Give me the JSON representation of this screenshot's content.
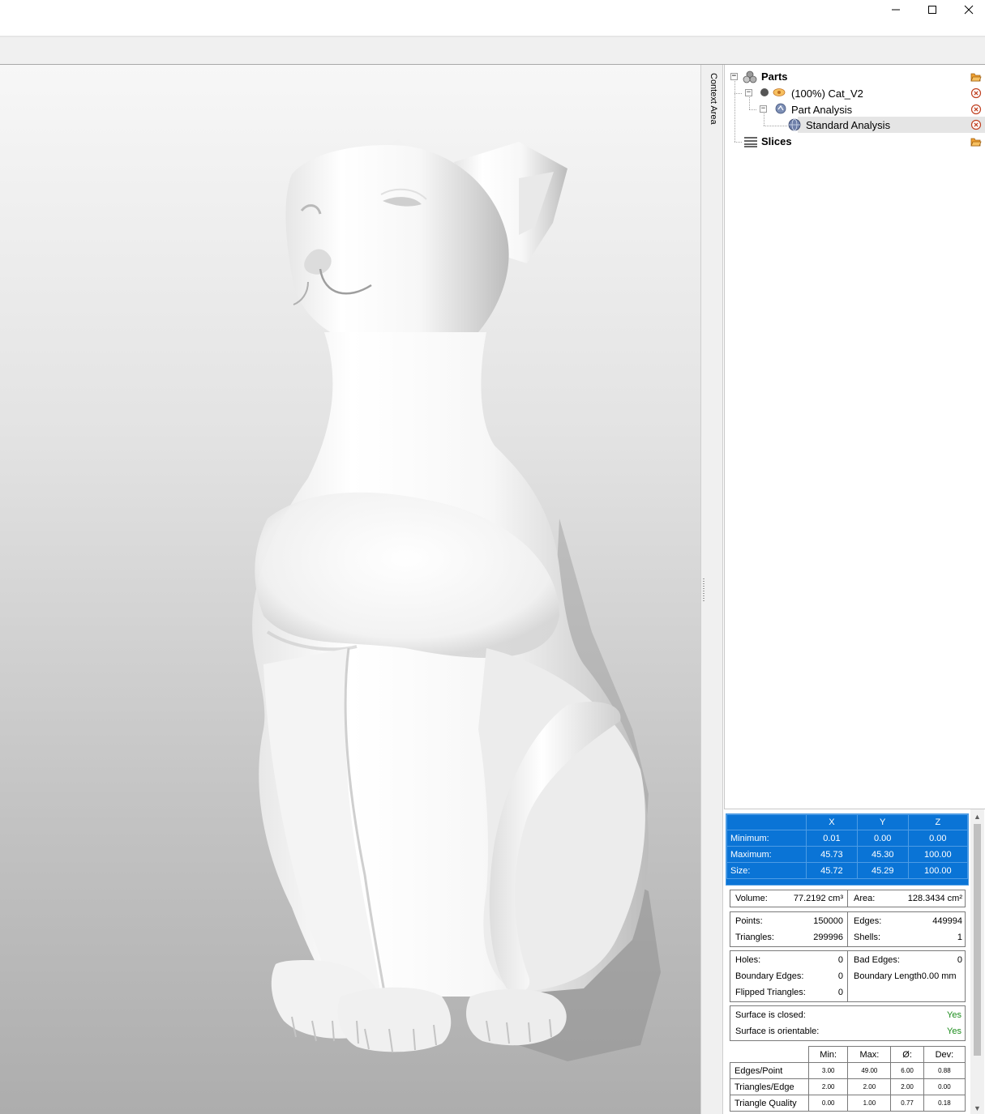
{
  "window": {
    "controls": [
      "minimize",
      "maximize",
      "close"
    ]
  },
  "viewport": {
    "model_name": "Cat_V2"
  },
  "context_tab": {
    "label": "Context Area"
  },
  "tree": {
    "parts_label": "Parts",
    "part_label": "(100%) Cat_V2",
    "analysis_label": "Part Analysis",
    "standard_analysis_label": "Standard Analysis",
    "slices_label": "Slices",
    "colors": {
      "selected_row": "#e5e5e5",
      "folder": "#f0a030",
      "remove": "#c04020"
    }
  },
  "analysis": {
    "bbox": {
      "headers": [
        "X",
        "Y",
        "Z"
      ],
      "rows": [
        {
          "label": "Minimum:",
          "x": "0.01",
          "y": "0.00",
          "z": "0.00"
        },
        {
          "label": "Maximum:",
          "x": "45.73",
          "y": "45.30",
          "z": "100.00"
        },
        {
          "label": "Size:",
          "x": "45.72",
          "y": "45.29",
          "z": "100.00"
        }
      ],
      "color": "#0a74d6"
    },
    "volume": {
      "label": "Volume:",
      "value": "77.2192 cm³"
    },
    "area": {
      "label": "Area:",
      "value": "128.3434 cm²"
    },
    "points": {
      "label": "Points:",
      "value": "150000"
    },
    "edges": {
      "label": "Edges:",
      "value": "449994"
    },
    "triangles": {
      "label": "Triangles:",
      "value": "299996"
    },
    "shells": {
      "label": "Shells:",
      "value": "1"
    },
    "holes": {
      "label": "Holes:",
      "value": "0"
    },
    "bad_edges": {
      "label": "Bad Edges:",
      "value": "0"
    },
    "boundary_edges": {
      "label": "Boundary Edges:",
      "value": "0"
    },
    "boundary_length": {
      "label": "Boundary Length",
      "value": "0.00 mm"
    },
    "flipped_triangles": {
      "label": "Flipped Triangles:",
      "value": "0"
    },
    "surface_closed": {
      "label": "Surface is closed:",
      "value": "Yes"
    },
    "surface_orientable": {
      "label": "Surface is orientable:",
      "value": "Yes"
    },
    "quality": {
      "headers": [
        "Min:",
        "Max:",
        "Ø:",
        "Dev:"
      ],
      "rows": [
        {
          "label": "Edges/Point",
          "min": "3.00",
          "max": "49.00",
          "avg": "6.00",
          "dev": "0.88"
        },
        {
          "label": "Triangles/Edge",
          "min": "2.00",
          "max": "2.00",
          "avg": "2.00",
          "dev": "0.00"
        },
        {
          "label": "Triangle Quality",
          "min": "0.00",
          "max": "1.00",
          "avg": "0.77",
          "dev": "0.18"
        }
      ]
    }
  }
}
